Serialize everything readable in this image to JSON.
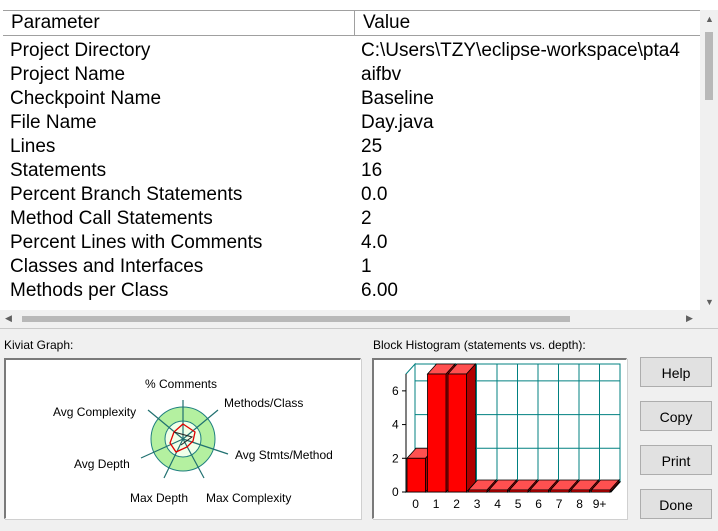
{
  "table": {
    "headers": {
      "parameter": "Parameter",
      "value": "Value"
    },
    "rows": [
      {
        "parameter": "Project Directory",
        "value": "C:\\Users\\TZY\\eclipse-workspace\\pta4"
      },
      {
        "parameter": "Project Name",
        "value": "aifbv"
      },
      {
        "parameter": "Checkpoint Name",
        "value": "Baseline"
      },
      {
        "parameter": "File Name",
        "value": "Day.java"
      },
      {
        "parameter": "Lines",
        "value": "25"
      },
      {
        "parameter": "Statements",
        "value": "16"
      },
      {
        "parameter": "Percent Branch Statements",
        "value": "0.0"
      },
      {
        "parameter": "Method Call Statements",
        "value": "2"
      },
      {
        "parameter": "Percent Lines with Comments",
        "value": "4.0"
      },
      {
        "parameter": "Classes and Interfaces",
        "value": "1"
      },
      {
        "parameter": "Methods per Class",
        "value": "6.00"
      }
    ]
  },
  "kiviat": {
    "label": "Kiviat Graph:",
    "axes": {
      "comments": "% Comments",
      "methods_class": "Methods/Class",
      "avg_stmts": "Avg Stmts/Method",
      "max_complexity": "Max Complexity",
      "max_depth": "Max Depth",
      "avg_depth": "Avg Depth",
      "avg_complexity": "Avg Complexity"
    },
    "colors": {
      "outer_ring": "#b4f0a0",
      "inner_ring": "#f0ffe8",
      "spokes": "#207070",
      "polygon": "#e00000"
    }
  },
  "histogram": {
    "label": "Block Histogram (statements vs. depth):",
    "bar_color": "#ff0000",
    "grid_color": "#008080"
  },
  "chart_data": {
    "type": "bar",
    "categories": [
      "0",
      "1",
      "2",
      "3",
      "4",
      "5",
      "6",
      "7",
      "8",
      "9+"
    ],
    "values": [
      2,
      7,
      7,
      0,
      0,
      0,
      0,
      0,
      0,
      0
    ],
    "yticks": [
      "0",
      "2",
      "4",
      "6"
    ],
    "ylim": [
      0,
      7
    ]
  },
  "buttons": {
    "help": "Help",
    "copy": "Copy",
    "print": "Print",
    "done": "Done"
  }
}
